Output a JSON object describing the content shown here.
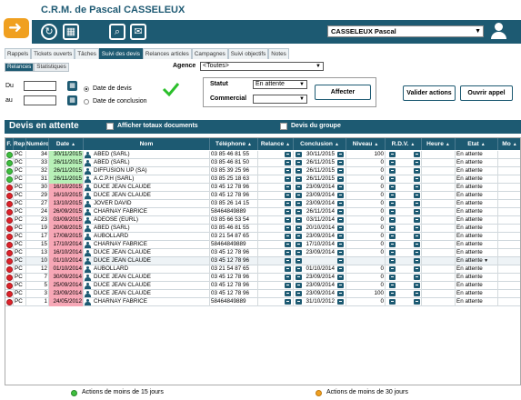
{
  "app": {
    "title": "C.R.M. de Pascal CASSELEUX"
  },
  "user": {
    "name": "CASSELEUX Pascal"
  },
  "tabs": [
    "Rappels",
    "Tickets ouverts",
    "Tâches",
    "Suivi des devis",
    "Relances articles",
    "Campagnes",
    "Suivi objectifs",
    "Notes"
  ],
  "active_tab": "Suivi des devis",
  "subtabs": [
    "Relances",
    "Statistiques"
  ],
  "agence": {
    "label": "Agence",
    "value": "<Toutes>"
  },
  "filters": {
    "du": "Du",
    "au": "au",
    "radio_devis": "Date de devis",
    "radio_conclusion": "Date de conclusion",
    "statut_label": "Statut",
    "statut_value": "En attente",
    "commercial_label": "Commercial",
    "affecter": "Affecter",
    "valider": "Valider actions",
    "ouvrir": "Ouvrir appel"
  },
  "section": {
    "title": "Devis en attente",
    "totaux": "Afficher totaux documents",
    "groupe": "Devis du groupe"
  },
  "columns": [
    "F.",
    "Rep.",
    "Numéro",
    "Date",
    "Nom",
    "Téléphone",
    "Relance",
    "Conclusion",
    "Niveau",
    "R.D.V.",
    "Heure",
    "Etat",
    "Mo"
  ],
  "rows": [
    {
      "dot": "green",
      "rep": "PC",
      "num": "34",
      "date": "30/11/2015",
      "dc": "g",
      "nom": "ABED (SARL)",
      "tel": "03 85 46 81 55",
      "concl": "30/11/2015",
      "niv": "100",
      "etat": "En attente"
    },
    {
      "dot": "green",
      "rep": "PC",
      "num": "33",
      "date": "26/11/2015",
      "dc": "g",
      "nom": "ABED (SARL)",
      "tel": "03 85 46 81 50",
      "concl": "26/11/2015",
      "niv": "0",
      "etat": "En attente"
    },
    {
      "dot": "green",
      "rep": "PC",
      "num": "32",
      "date": "26/11/2015",
      "dc": "g",
      "nom": "DIFFUSION UP (SA)",
      "tel": "03 85 39 25 96",
      "concl": "26/11/2015",
      "niv": "0",
      "etat": "En attente"
    },
    {
      "dot": "green",
      "rep": "PC",
      "num": "31",
      "date": "26/11/2015",
      "dc": "g",
      "nom": "A.C.P.H (SARL)",
      "tel": "03 85 25 18 63",
      "concl": "26/11/2015",
      "niv": "0",
      "etat": "En attente"
    },
    {
      "dot": "red",
      "rep": "PC",
      "num": "30",
      "date": "16/10/2015",
      "dc": "r",
      "nom": "DUCE JEAN CLAUDE",
      "tel": "03 45 12 78 96",
      "concl": "23/09/2014",
      "niv": "0",
      "etat": "En attente"
    },
    {
      "dot": "red",
      "rep": "PC",
      "num": "29",
      "date": "16/10/2015",
      "dc": "r",
      "nom": "DUCE JEAN CLAUDE",
      "tel": "03 45 12 78 96",
      "concl": "23/09/2014",
      "niv": "0",
      "etat": "En attente"
    },
    {
      "dot": "red",
      "rep": "PC",
      "num": "27",
      "date": "13/10/2015",
      "dc": "r",
      "nom": "JOVER DAVID",
      "tel": "03 85 26 14 15",
      "concl": "23/09/2014",
      "niv": "0",
      "etat": "En attente"
    },
    {
      "dot": "red",
      "rep": "PC",
      "num": "24",
      "date": "26/09/2015",
      "dc": "r",
      "nom": "CHARNAY FABRICE",
      "tel": "58464849889",
      "concl": "26/11/2014",
      "niv": "0",
      "etat": "En attente"
    },
    {
      "dot": "red",
      "rep": "PC",
      "num": "23",
      "date": "03/09/2015",
      "dc": "r",
      "nom": "ADEOSE (EURL)",
      "tel": "03 85 66 53 54",
      "concl": "03/11/2014",
      "niv": "0",
      "etat": "En attente"
    },
    {
      "dot": "red",
      "rep": "PC",
      "num": "19",
      "date": "20/08/2015",
      "dc": "r",
      "nom": "ABED (SARL)",
      "tel": "03 85 46 81 55",
      "concl": "20/10/2014",
      "niv": "0",
      "etat": "En attente"
    },
    {
      "dot": "red",
      "rep": "PC",
      "num": "17",
      "date": "17/08/2015",
      "dc": "r",
      "nom": "AUBOLLARD",
      "tel": "03 21 54 87 65",
      "concl": "23/09/2014",
      "niv": "0",
      "etat": "En attente"
    },
    {
      "dot": "red",
      "rep": "PC",
      "num": "15",
      "date": "17/10/2014",
      "dc": "r",
      "nom": "CHARNAY FABRICE",
      "tel": "58464849889",
      "concl": "17/10/2014",
      "niv": "0",
      "etat": "En attente"
    },
    {
      "dot": "red",
      "rep": "PC",
      "num": "13",
      "date": "16/10/2014",
      "dc": "r",
      "nom": "DUCE JEAN CLAUDE",
      "tel": "03 45 12 78 96",
      "concl": "23/09/2014",
      "niv": "0",
      "etat": "En attente"
    },
    {
      "dot": "red",
      "rep": "PC",
      "num": "10",
      "date": "01/10/2014",
      "dc": "r",
      "nom": "DUCE JEAN CLAUDE",
      "tel": "03 45 12 78 96",
      "concl": "",
      "niv": "",
      "etat": "En attente",
      "selected": true
    },
    {
      "dot": "red",
      "rep": "PC",
      "num": "12",
      "date": "01/10/2014",
      "dc": "r",
      "nom": "AUBOLLARD",
      "tel": "03 21 54 87 65",
      "concl": "01/10/2014",
      "niv": "0",
      "etat": "En attente"
    },
    {
      "dot": "red",
      "rep": "PC",
      "num": "7",
      "date": "30/09/2014",
      "dc": "r",
      "nom": "DUCE JEAN CLAUDE",
      "tel": "03 45 12 78 96",
      "concl": "23/09/2014",
      "niv": "0",
      "etat": "En attente"
    },
    {
      "dot": "red",
      "rep": "PC",
      "num": "5",
      "date": "25/09/2014",
      "dc": "r",
      "nom": "DUCE JEAN CLAUDE",
      "tel": "03 45 12 78 96",
      "concl": "23/09/2014",
      "niv": "0",
      "etat": "En attente"
    },
    {
      "dot": "red",
      "rep": "PC",
      "num": "3",
      "date": "23/09/2014",
      "dc": "r",
      "nom": "DUCE JEAN CLAUDE",
      "tel": "03 45 12 78 96",
      "concl": "23/09/2014",
      "niv": "100",
      "etat": "En attente"
    },
    {
      "dot": "red",
      "rep": "PC",
      "num": "1",
      "date": "24/05/2012",
      "dc": "r",
      "nom": "CHARNAY FABRICE",
      "tel": "58464849889",
      "concl": "31/10/2012",
      "niv": "0",
      "etat": "En attente"
    }
  ],
  "legend": {
    "green": "Actions de moins de 15 jours",
    "orange": "Actions de moins de 30 jours"
  },
  "colors": {
    "accent": "#1d5a72",
    "orange": "#f0a020",
    "green": "#3fbf3f",
    "red": "#e0222a"
  }
}
